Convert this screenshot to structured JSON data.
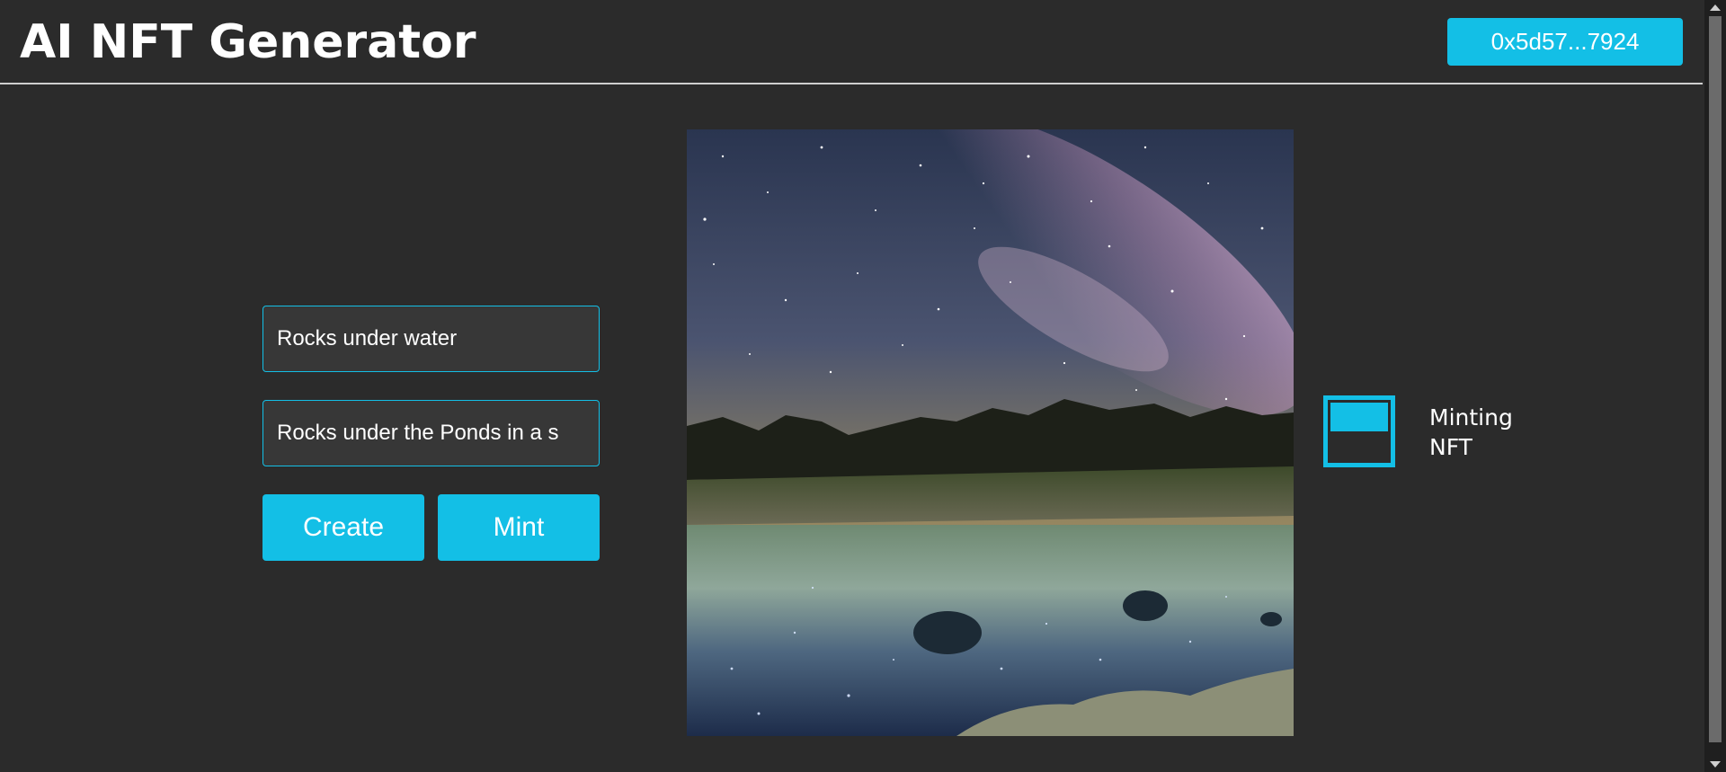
{
  "header": {
    "title": "AI NFT Generator",
    "wallet_address": "0x5d57...7924"
  },
  "form": {
    "name_value": "Rocks under water",
    "description_value": "Rocks under the Ponds in a s",
    "create_label": "Create",
    "mint_label": "Mint"
  },
  "status": {
    "line1": "Minting",
    "line2": "NFT"
  },
  "nft_image": {
    "description_icon": "night-sky-pond-image"
  },
  "colors": {
    "background": "#2b2b2b",
    "accent": "#13bfe6",
    "input_background": "#373737"
  }
}
